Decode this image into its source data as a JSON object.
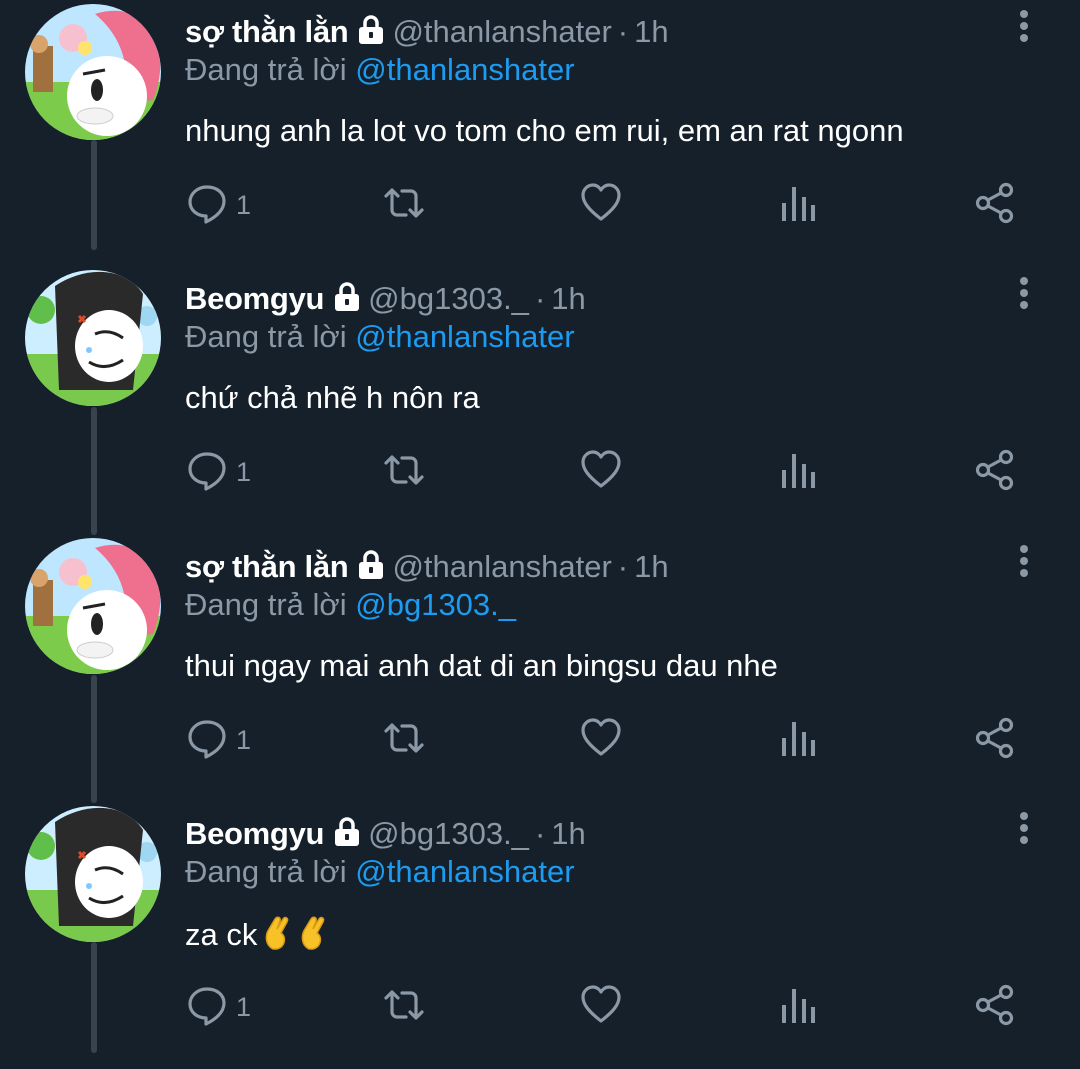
{
  "reply_prefix": "Đang trả lời",
  "colors": {
    "background": "#15202b",
    "secondary_text": "#8b98a5",
    "mention": "#1d9bf0",
    "thread_line": "#38444d"
  },
  "tweets": [
    {
      "name": "sợ thằn lằn",
      "handle": "@thanlanshater",
      "time": "1h",
      "replying_to": "@thanlanshater",
      "text": "nhung anh la lot vo tom cho em rui, em an rat ngonn",
      "reply_count": "1",
      "avatar": "pink-bunny-avatar"
    },
    {
      "name": "Beomgyu",
      "handle": "@bg1303._",
      "time": "1h",
      "replying_to": "@thanlanshater",
      "text": "chứ chả nhẽ h nôn ra",
      "reply_count": "1",
      "avatar": "black-bunny-avatar"
    },
    {
      "name": "sợ thằn lằn",
      "handle": "@thanlanshater",
      "time": "1h",
      "replying_to": "@bg1303._",
      "text": "thui ngay mai anh dat di an bingsu dau nhe",
      "reply_count": "1",
      "avatar": "pink-bunny-avatar"
    },
    {
      "name": "Beomgyu",
      "handle": "@bg1303._",
      "time": "1h",
      "replying_to": "@thanlanshater",
      "text": "za ck",
      "emojis": "🤞🤞",
      "reply_count": "1",
      "avatar": "black-bunny-avatar"
    }
  ]
}
